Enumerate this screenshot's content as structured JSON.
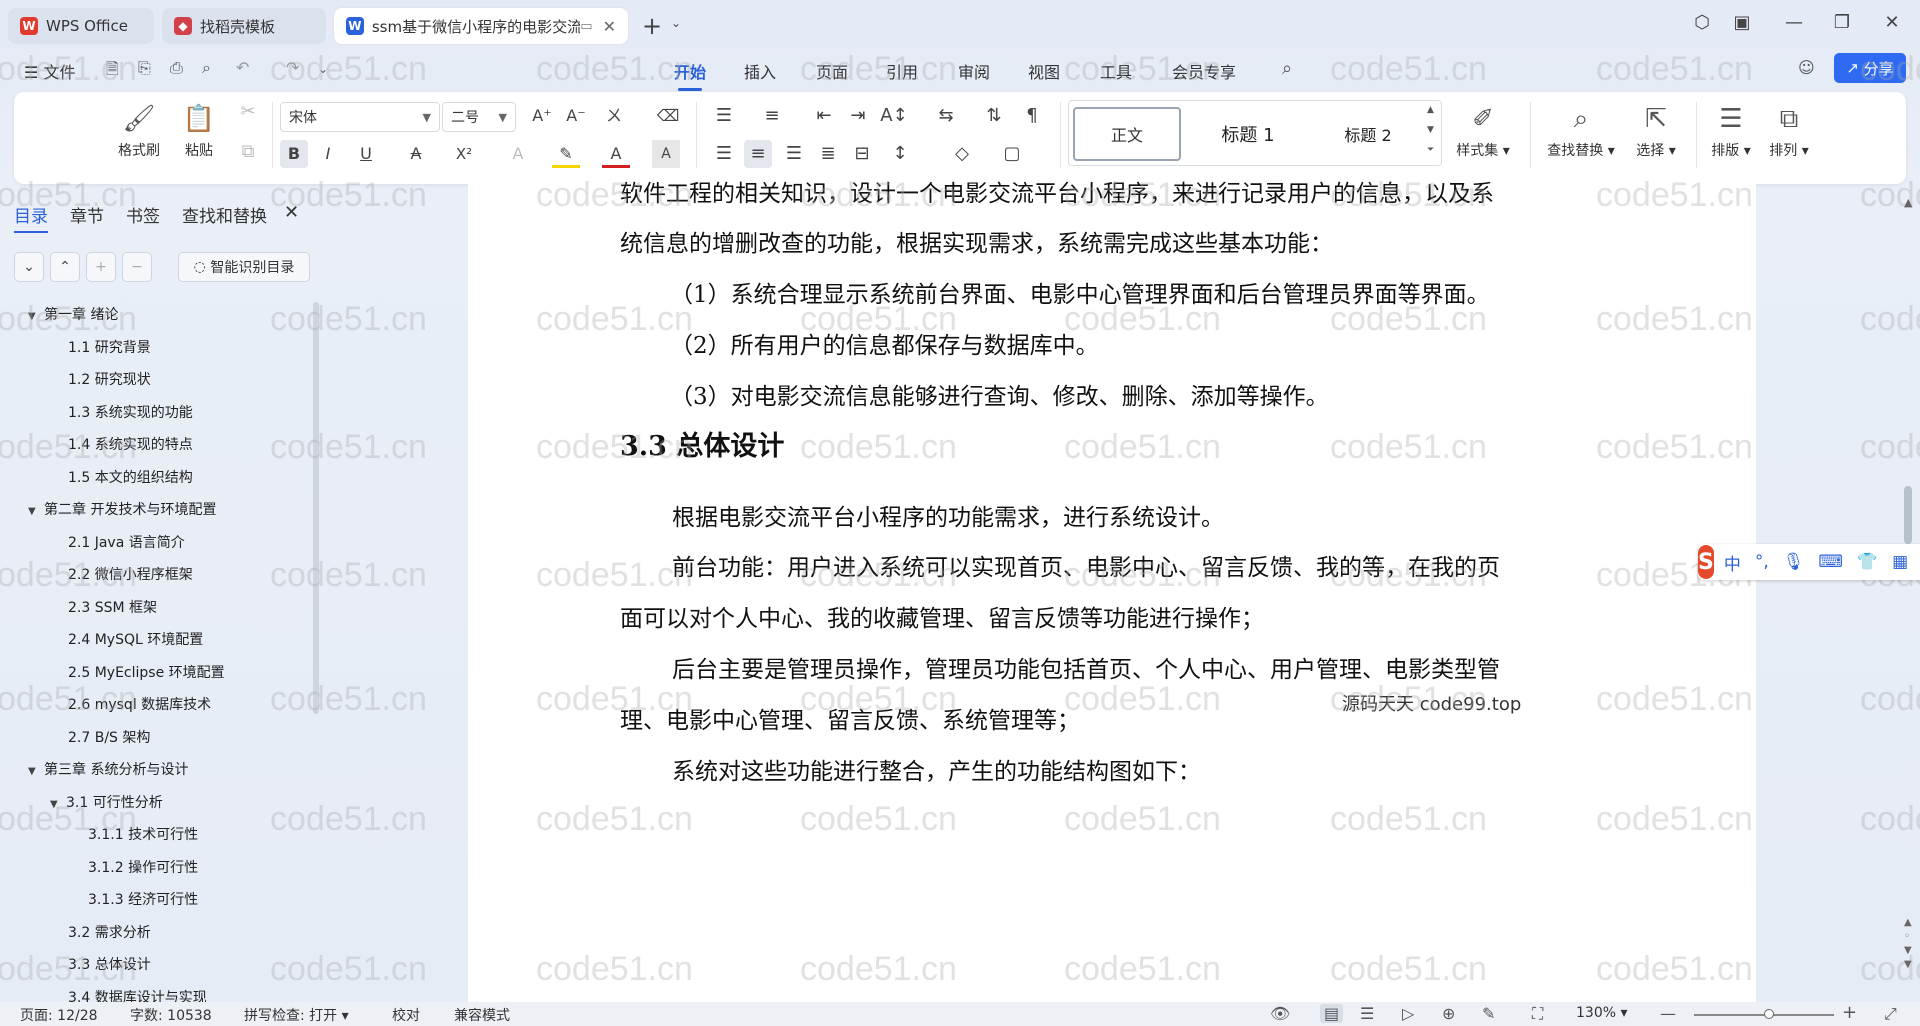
{
  "tabs": [
    {
      "label": "WPS Office",
      "icon": "wps-logo-icon"
    },
    {
      "label": "找稻壳模板",
      "icon": "docer-icon"
    },
    {
      "label": "ssm基于微信小程序的电影交流",
      "icon": "word-doc-icon"
    }
  ],
  "menu": {
    "file": "文件",
    "items": [
      "开始",
      "插入",
      "页面",
      "引用",
      "审阅",
      "视图",
      "工具",
      "会员专享"
    ],
    "share": "分享"
  },
  "ribbon": {
    "format_painter": "格式刷",
    "paste": "粘贴",
    "font_name": "宋体",
    "font_size": "二号",
    "styles": [
      "正文",
      "标题 1",
      "标题 2"
    ],
    "style_set": "样式集",
    "find_replace": "查找替换",
    "select": "选择",
    "layout": "排版",
    "arrange": "排列"
  },
  "nav_panel": {
    "tabs": [
      "目录",
      "章节",
      "书签",
      "查找和替换"
    ],
    "smart_button": "智能识别目录",
    "toc": [
      {
        "text": "第一章  绪论",
        "level": 0,
        "expanded": true
      },
      {
        "text": "1.1   研究背景",
        "level": 1
      },
      {
        "text": "1.2   研究现状",
        "level": 1
      },
      {
        "text": "1.3   系统实现的功能",
        "level": 1
      },
      {
        "text": "1.4   系统实现的特点",
        "level": 1
      },
      {
        "text": "1.5   本文的组织结构",
        "level": 1
      },
      {
        "text": "第二章  开发技术与环境配置",
        "level": 0,
        "expanded": true
      },
      {
        "text": "2.1   Java 语言简介",
        "level": 1
      },
      {
        "text": "2.2   微信小程序框架",
        "level": 1
      },
      {
        "text": "2.3   SSM 框架",
        "level": 1
      },
      {
        "text": "2.4   MySQL 环境配置",
        "level": 1
      },
      {
        "text": "2.5   MyEclipse 环境配置",
        "level": 1
      },
      {
        "text": "2.6   mysql 数据库技术",
        "level": 1
      },
      {
        "text": "2.7   B/S 架构",
        "level": 1
      },
      {
        "text": "第三章  系统分析与设计",
        "level": 0,
        "expanded": true
      },
      {
        "text": "3.1  可行性分析",
        "level": 1,
        "expanded": true
      },
      {
        "text": "3.1.1  技术可行性",
        "level": 2
      },
      {
        "text": "3.1.2  操作可行性",
        "level": 2
      },
      {
        "text": "3.1.3 经济可行性",
        "level": 2
      },
      {
        "text": "3.2   需求分析",
        "level": 1
      },
      {
        "text": "3.3   总体设计",
        "level": 1
      },
      {
        "text": "3.4   数据库设计与实现",
        "level": 1
      }
    ]
  },
  "document": {
    "lines": [
      "软件工程的相关知识，设计一个电影交流平台小程序，来进行记录用户的信息，以及系",
      "统信息的增删改查的功能，根据实现需求，系统需完成这些基本功能：",
      "（1）系统合理显示系统前台界面、电影中心管理界面和后台管理员界面等界面。",
      "（2）所有用户的信息都保存与数据库中。",
      "（3）对电影交流信息能够进行查询、修改、删除、添加等操作。",
      "3.3   总体设计",
      "根据电影交流平台小程序的功能需求，进行系统设计。",
      "前台功能：用户进入系统可以实现首页、电影中心、留言反馈、我的等，在我的页",
      "面可以对个人中心、我的收藏管理、留言反馈等功能进行操作；",
      "后台主要是管理员操作，管理员功能包括首页、个人中心、用户管理、电影类型管",
      "理、电影中心管理、留言反馈、系统管理等；",
      "系统对这些功能进行整合，产生的功能结构图如下："
    ],
    "overlay_text": "源码天天 code99.top",
    "watermark": "code51.cn"
  },
  "ime": {
    "items": [
      "中",
      "°,"
    ]
  },
  "status": {
    "page": "页面: 12/28",
    "words": "字数: 10538",
    "spell": "拼写检查: 打开",
    "proof": "校对",
    "compat": "兼容模式",
    "zoom": "130%"
  },
  "colors": {
    "accent": "#2b62d9",
    "share_bg": "#2f6bf2",
    "wps_red": "#e33a2f"
  }
}
